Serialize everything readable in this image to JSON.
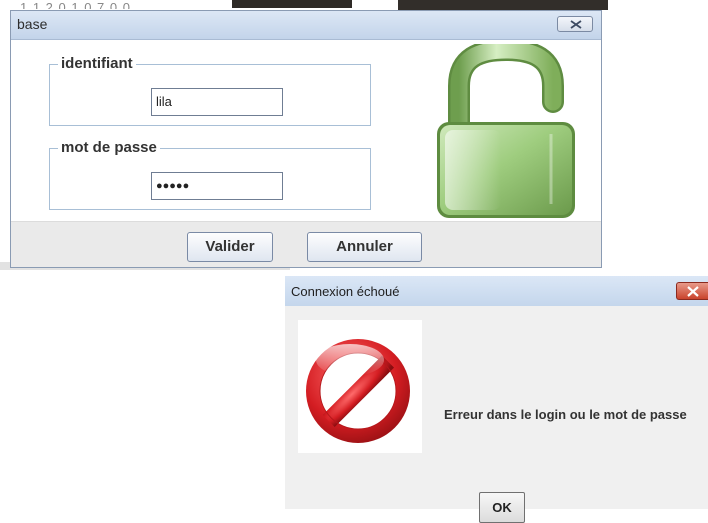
{
  "login_window": {
    "title": "base",
    "username": {
      "label": "identifiant",
      "value": "lila"
    },
    "password": {
      "label": "mot de passe",
      "value": "●●●●●"
    },
    "buttons": {
      "validate": "Valider",
      "cancel": "Annuler"
    },
    "icons": {
      "close": "close-icon",
      "lock": "open-padlock-icon"
    }
  },
  "error_dialog": {
    "title": "Connexion échoué",
    "message": "Erreur dans le login ou le mot de passe",
    "ok_label": "OK",
    "icons": {
      "close": "close-icon",
      "error": "forbidden-sign-icon"
    }
  },
  "background": {
    "top_text": "1 1 2 0 1 0 7 0 0"
  },
  "colors": {
    "lock_green": "#8fc46a",
    "error_red": "#d41d22",
    "close_red": "#c9432c"
  }
}
